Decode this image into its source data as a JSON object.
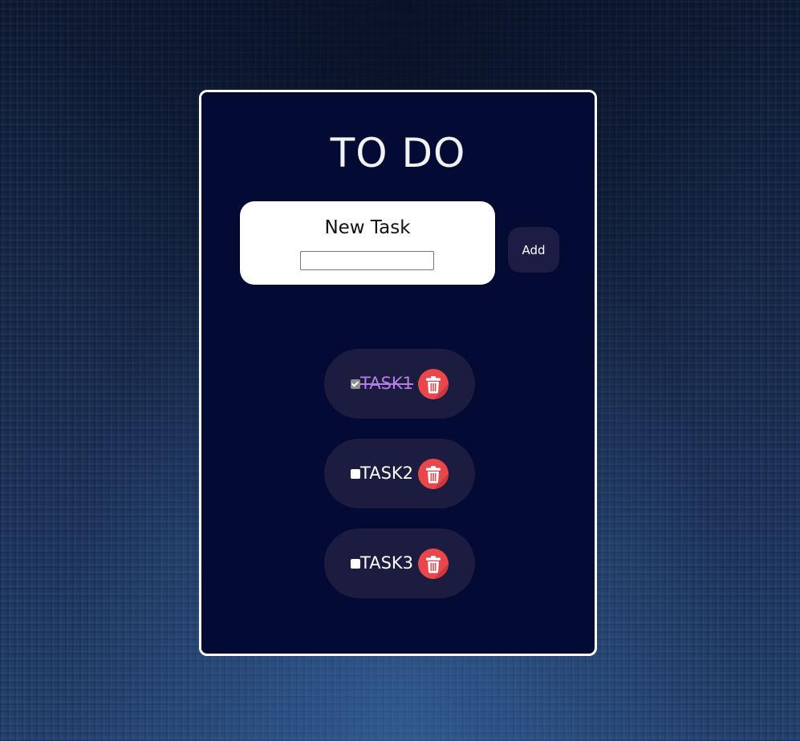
{
  "app": {
    "title": "TO DO"
  },
  "new_task": {
    "label": "New Task",
    "input_value": "",
    "add_label": "Add"
  },
  "tasks": [
    {
      "label": "TASK1",
      "done": true
    },
    {
      "label": "TASK2",
      "done": false
    },
    {
      "label": "TASK3",
      "done": false
    }
  ],
  "icons": {
    "delete": "trash-icon",
    "checkbox": "checkbox-icon"
  },
  "colors": {
    "card_background": "#030a33",
    "card_border": "#ffffff",
    "task_background": "#1c1c40",
    "done_text": "#b07fe0",
    "delete_button": "#e9474c",
    "add_button": "#1c1c44"
  }
}
